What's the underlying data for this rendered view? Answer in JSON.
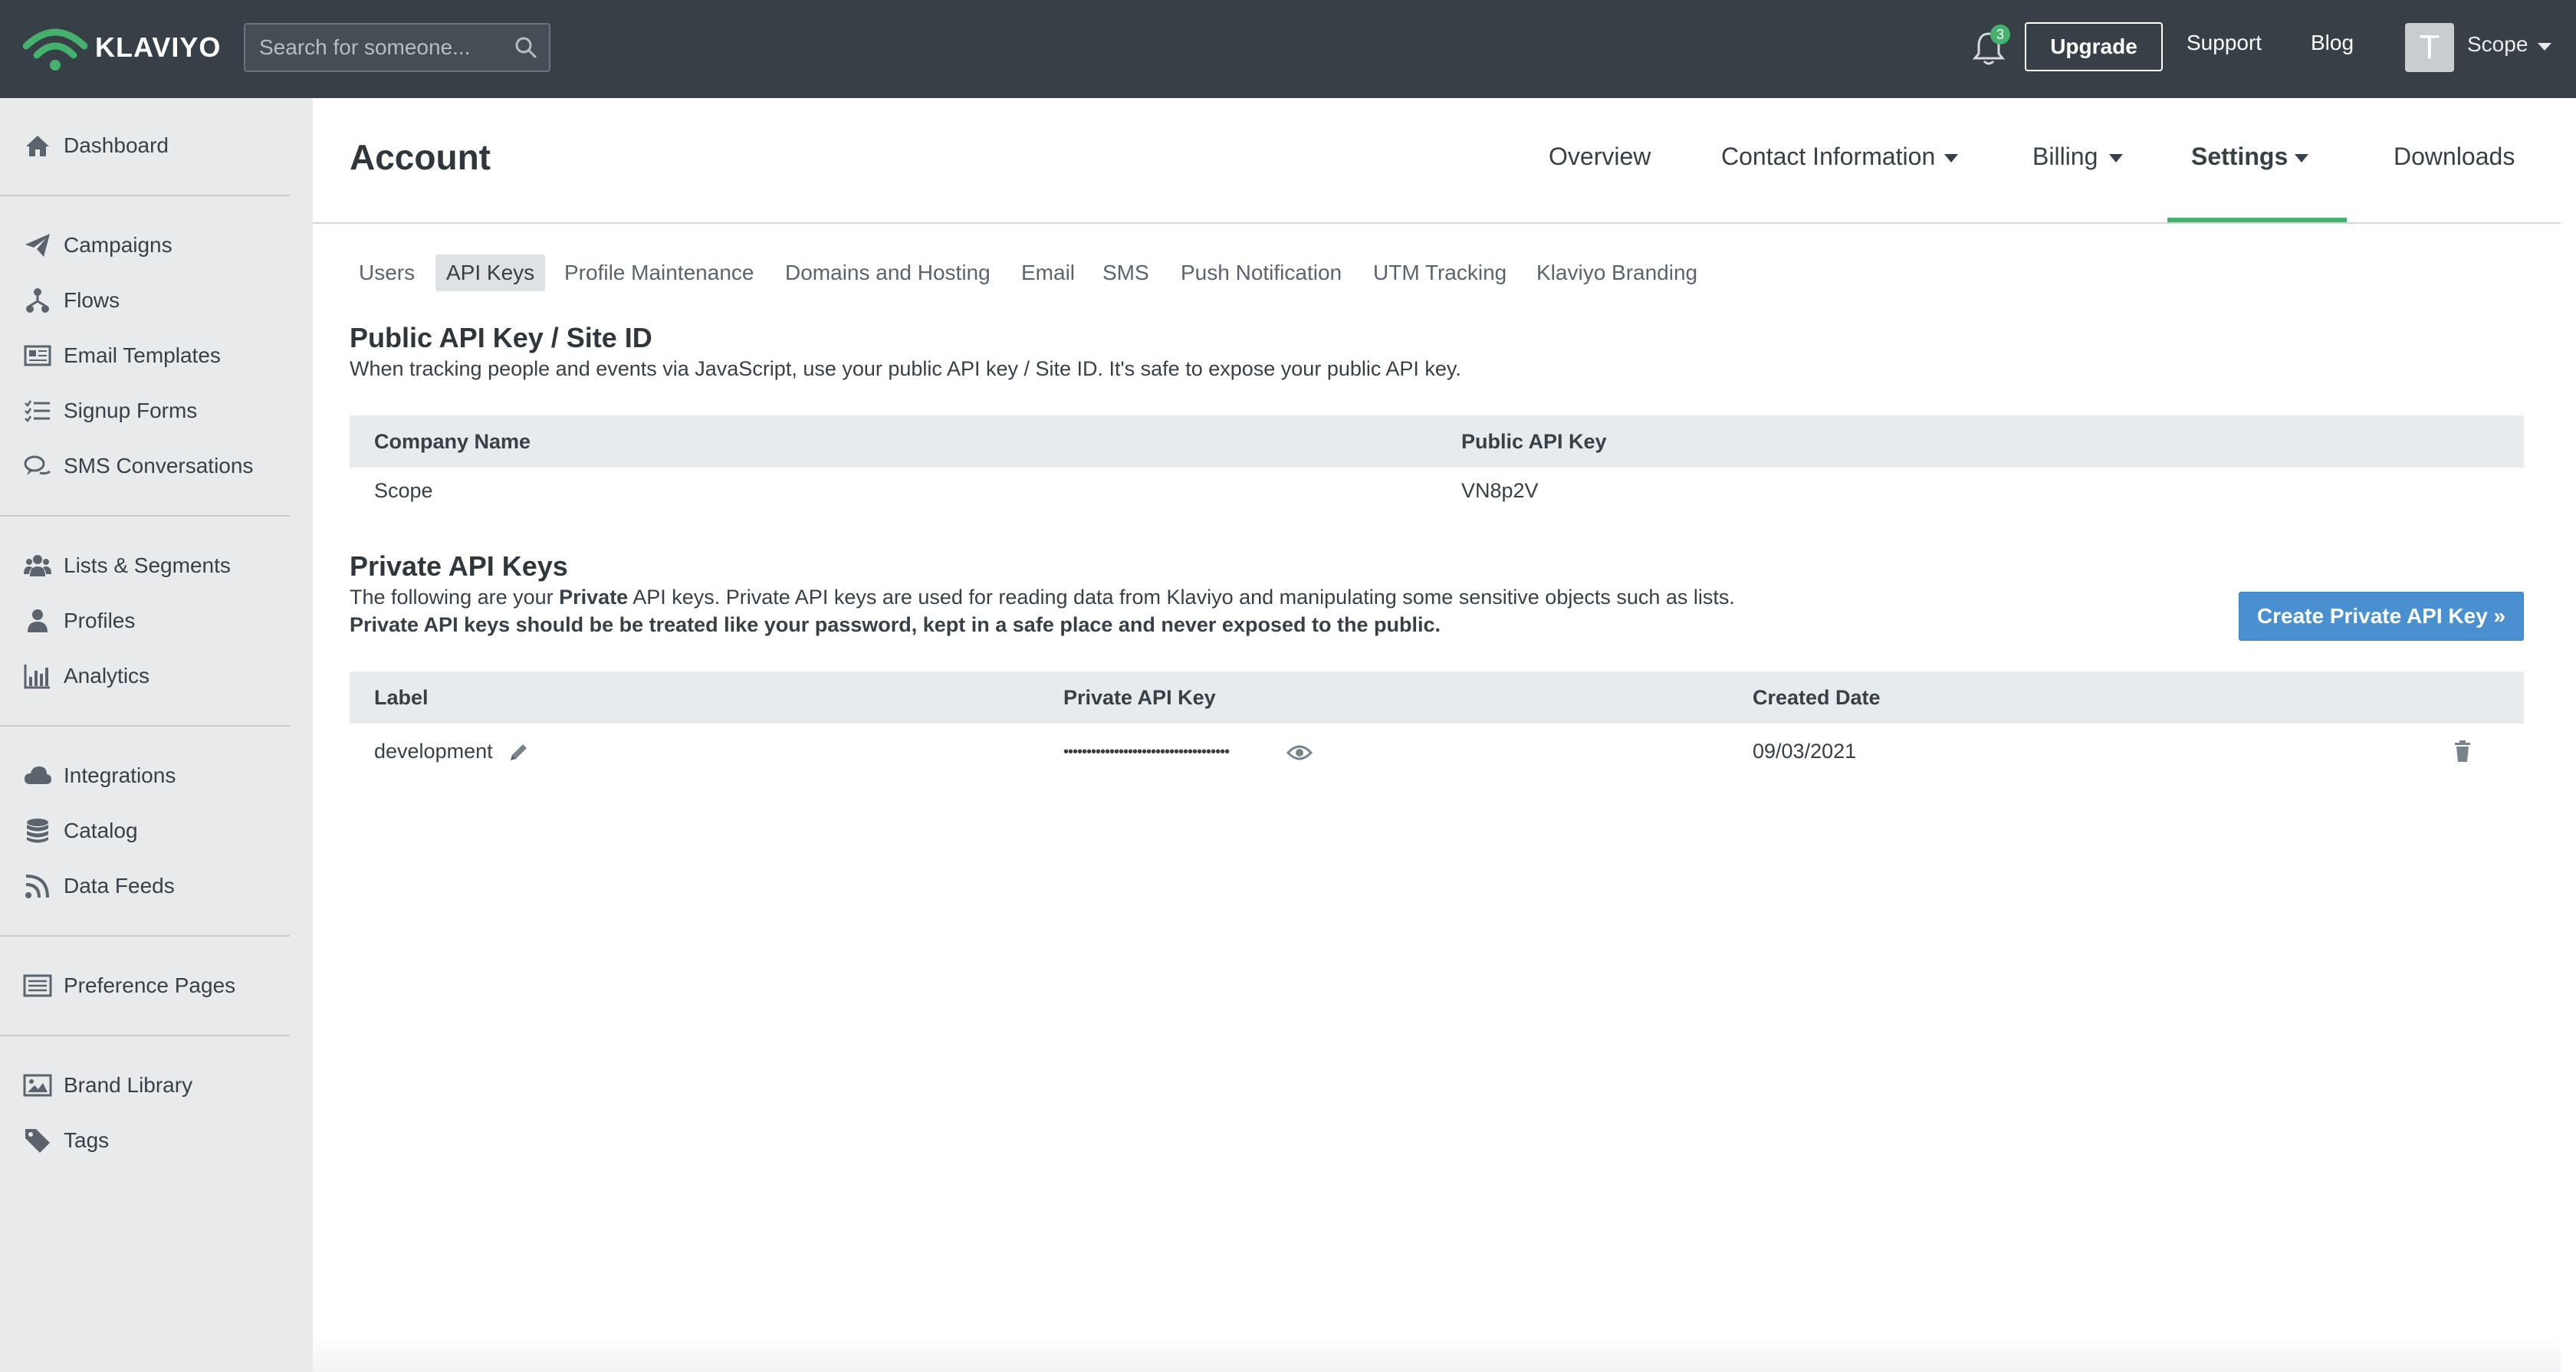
{
  "brand": {
    "name": "KLAVIYO",
    "green": "#46b06f",
    "topbar_color": "#373f47"
  },
  "search": {
    "placeholder": "Search for someone..."
  },
  "header": {
    "notification_count": "3",
    "upgrade_label": "Upgrade",
    "support_label": "Support",
    "blog_label": "Blog",
    "avatar_initial": "T",
    "user_name": "Scope"
  },
  "sidebar": {
    "items": [
      {
        "label": "Dashboard",
        "icon": "home-icon"
      },
      {
        "label": "Campaigns",
        "icon": "paper-plane-icon"
      },
      {
        "label": "Flows",
        "icon": "flows-icon"
      },
      {
        "label": "Email Templates",
        "icon": "newspaper-icon"
      },
      {
        "label": "Signup Forms",
        "icon": "list-check-icon"
      },
      {
        "label": "SMS Conversations",
        "icon": "chat-bubbles-icon"
      },
      {
        "label": "Lists & Segments",
        "icon": "users-icon"
      },
      {
        "label": "Profiles",
        "icon": "user-icon"
      },
      {
        "label": "Analytics",
        "icon": "bar-chart-icon"
      },
      {
        "label": "Integrations",
        "icon": "cloud-icon"
      },
      {
        "label": "Catalog",
        "icon": "database-icon"
      },
      {
        "label": "Data Feeds",
        "icon": "rss-icon"
      },
      {
        "label": "Preference Pages",
        "icon": "list-alt-icon"
      },
      {
        "label": "Brand Library",
        "icon": "image-icon"
      },
      {
        "label": "Tags",
        "icon": "tag-icon"
      }
    ]
  },
  "page": {
    "title": "Account",
    "tabs": [
      {
        "label": "Overview"
      },
      {
        "label": "Contact Information"
      },
      {
        "label": "Billing"
      },
      {
        "label": "Settings"
      },
      {
        "label": "Downloads"
      }
    ],
    "active_tab": "Settings"
  },
  "subtabs": {
    "items": [
      {
        "label": "Users"
      },
      {
        "label": "API Keys"
      },
      {
        "label": "Profile Maintenance"
      },
      {
        "label": "Domains and Hosting"
      },
      {
        "label": "Email"
      },
      {
        "label": "SMS"
      },
      {
        "label": "Push Notification"
      },
      {
        "label": "UTM Tracking"
      },
      {
        "label": "Klaviyo Branding"
      }
    ],
    "active": "API Keys"
  },
  "public_api": {
    "title": "Public API Key / Site ID",
    "description": "When tracking people and events via JavaScript, use your public API key / Site ID. It's safe to expose your public API key.",
    "columns": [
      "Company Name",
      "Public API Key"
    ],
    "rows": [
      {
        "company": "Scope",
        "key": "VN8p2V"
      }
    ]
  },
  "private_api": {
    "title": "Private API Keys",
    "desc_prefix": "The following are your ",
    "desc_bold": "Private",
    "desc_suffix": " API keys. Private API keys are used for reading data from Klaviyo and manipulating some sensitive objects such as lists.",
    "warning": "Private API keys should be be treated like your password, kept in a safe place and never exposed to the public.",
    "create_button": "Create Private API Key »",
    "columns": [
      "Label",
      "Private API Key",
      "Created Date"
    ],
    "rows": [
      {
        "label": "development",
        "key_masked": "••••••••••••••••••••••••••••••••••••",
        "created": "09/03/2021"
      }
    ]
  }
}
